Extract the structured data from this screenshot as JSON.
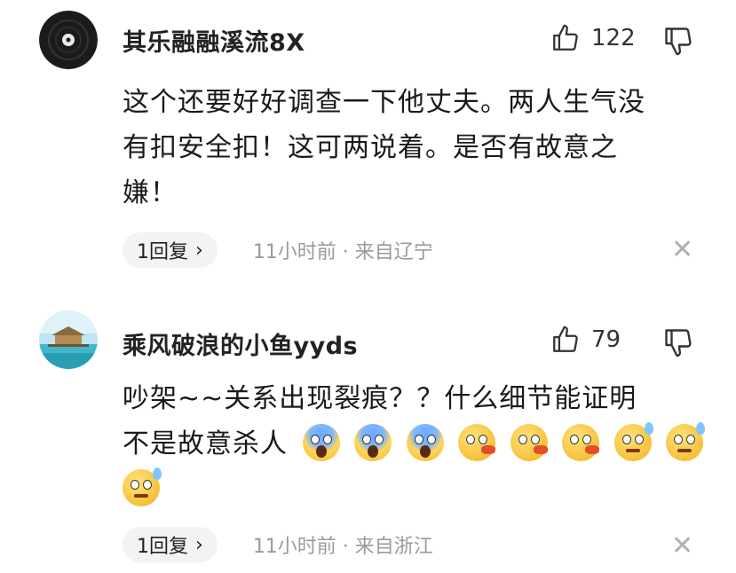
{
  "comments": [
    {
      "username": "其乐融融溪流8X",
      "likes": "122",
      "text_lines": [
        "这个还要好好调查一下他丈夫。两人生气没",
        "有扣安全扣！这可两说着。是否有故意之",
        "嫌！"
      ],
      "reply_label": "1回复",
      "time": "11小时前 · 来自辽宁"
    },
    {
      "username": "乘风破浪的小鱼yyds",
      "likes": "79",
      "text_lines": [
        "吵架~~关系出现裂痕？？什么细节能证明",
        "不是故意杀人"
      ],
      "emojis": [
        "scream",
        "scream",
        "scream",
        "blow",
        "blow",
        "blow",
        "smirk",
        "smirk",
        "smirk"
      ],
      "reply_label": "1回复",
      "time": "11小时前 · 来自浙江"
    }
  ],
  "icons": {
    "like": "thumbs-up-outline",
    "dislike": "thumbs-down-outline",
    "close": "x-icon",
    "chevron": "chevron-right"
  }
}
